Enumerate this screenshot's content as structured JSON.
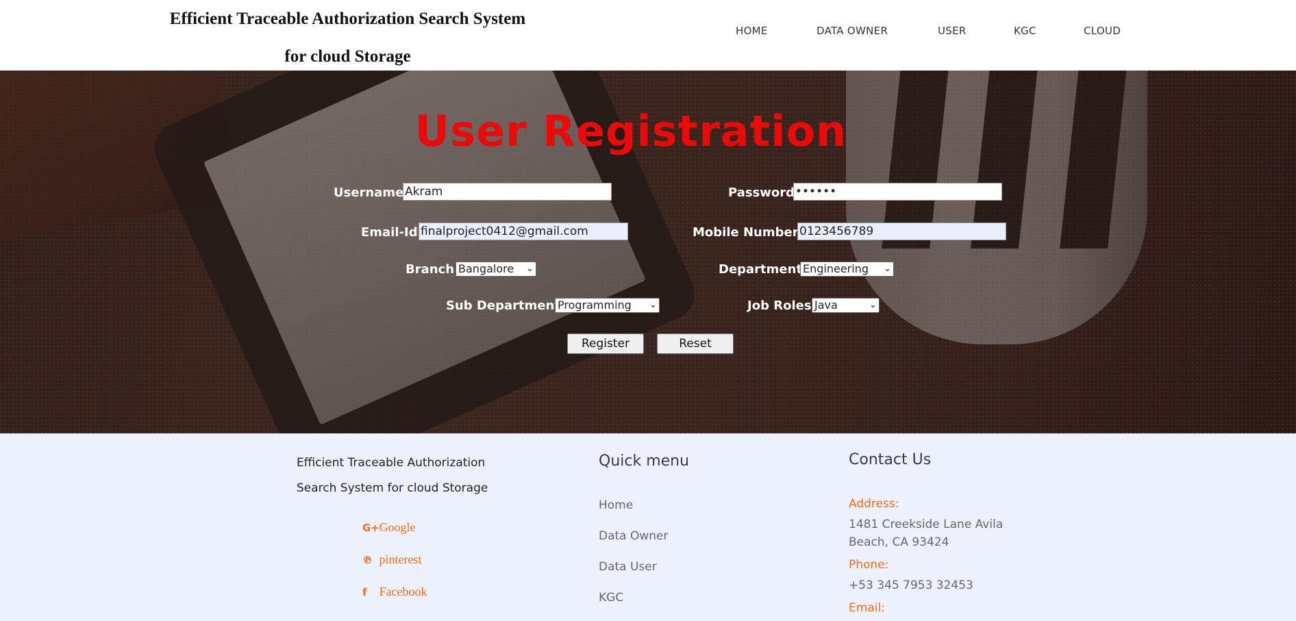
{
  "header": {
    "title_line1": "Efficient Traceable Authorization Search System",
    "title_line2": "for cloud Storage",
    "nav": [
      "HOME",
      "DATA OWNER",
      "USER",
      "KGC",
      "CLOUD"
    ]
  },
  "form": {
    "title": "User Registration",
    "username_label": "Username:",
    "username_value": "Akram",
    "password_label": "Password:",
    "password_value": "••••••",
    "email_label": "Email-Id:",
    "email_value": "finalproject0412@gmail.com",
    "mobile_label": "Mobile Number :",
    "mobile_value": "0123456789",
    "branch_label": "Branch:",
    "branch_value": "Bangalore",
    "department_label": "Department:",
    "department_value": "Engineering",
    "subdept_label": "Sub Department:",
    "subdept_value": "Programming",
    "jobroles_label": "Job Roles:",
    "jobroles_value": "Java",
    "register_label": "Register",
    "reset_label": "Reset"
  },
  "footer": {
    "about_line1": "Efficient Traceable Authorization",
    "about_line2": "Search System for cloud Storage",
    "social": [
      {
        "icon": "google-plus-icon",
        "glyph": "G+",
        "label": "Google"
      },
      {
        "icon": "pinterest-icon",
        "glyph": "℗",
        "label": "pinterest"
      },
      {
        "icon": "facebook-icon",
        "glyph": "f",
        "label": "Facebook"
      }
    ],
    "quick_menu_title": "Quick menu",
    "quick_menu": [
      "Home",
      "Data Owner",
      "Data User",
      "KGC"
    ],
    "contact_title": "Contact Us",
    "address_label": "Address:",
    "address_text": "1481 Creekside Lane Avila Beach, CA 93424",
    "phone_label": "Phone:",
    "phone_text": "+53 345 7953 32453",
    "email_label": "Email:"
  },
  "colors": {
    "accent_red": "#ea0a0a",
    "footer_orange": "#f06b1a",
    "footer_bg": "#ecf1fd",
    "autofill_bg": "#e8f0fe"
  }
}
